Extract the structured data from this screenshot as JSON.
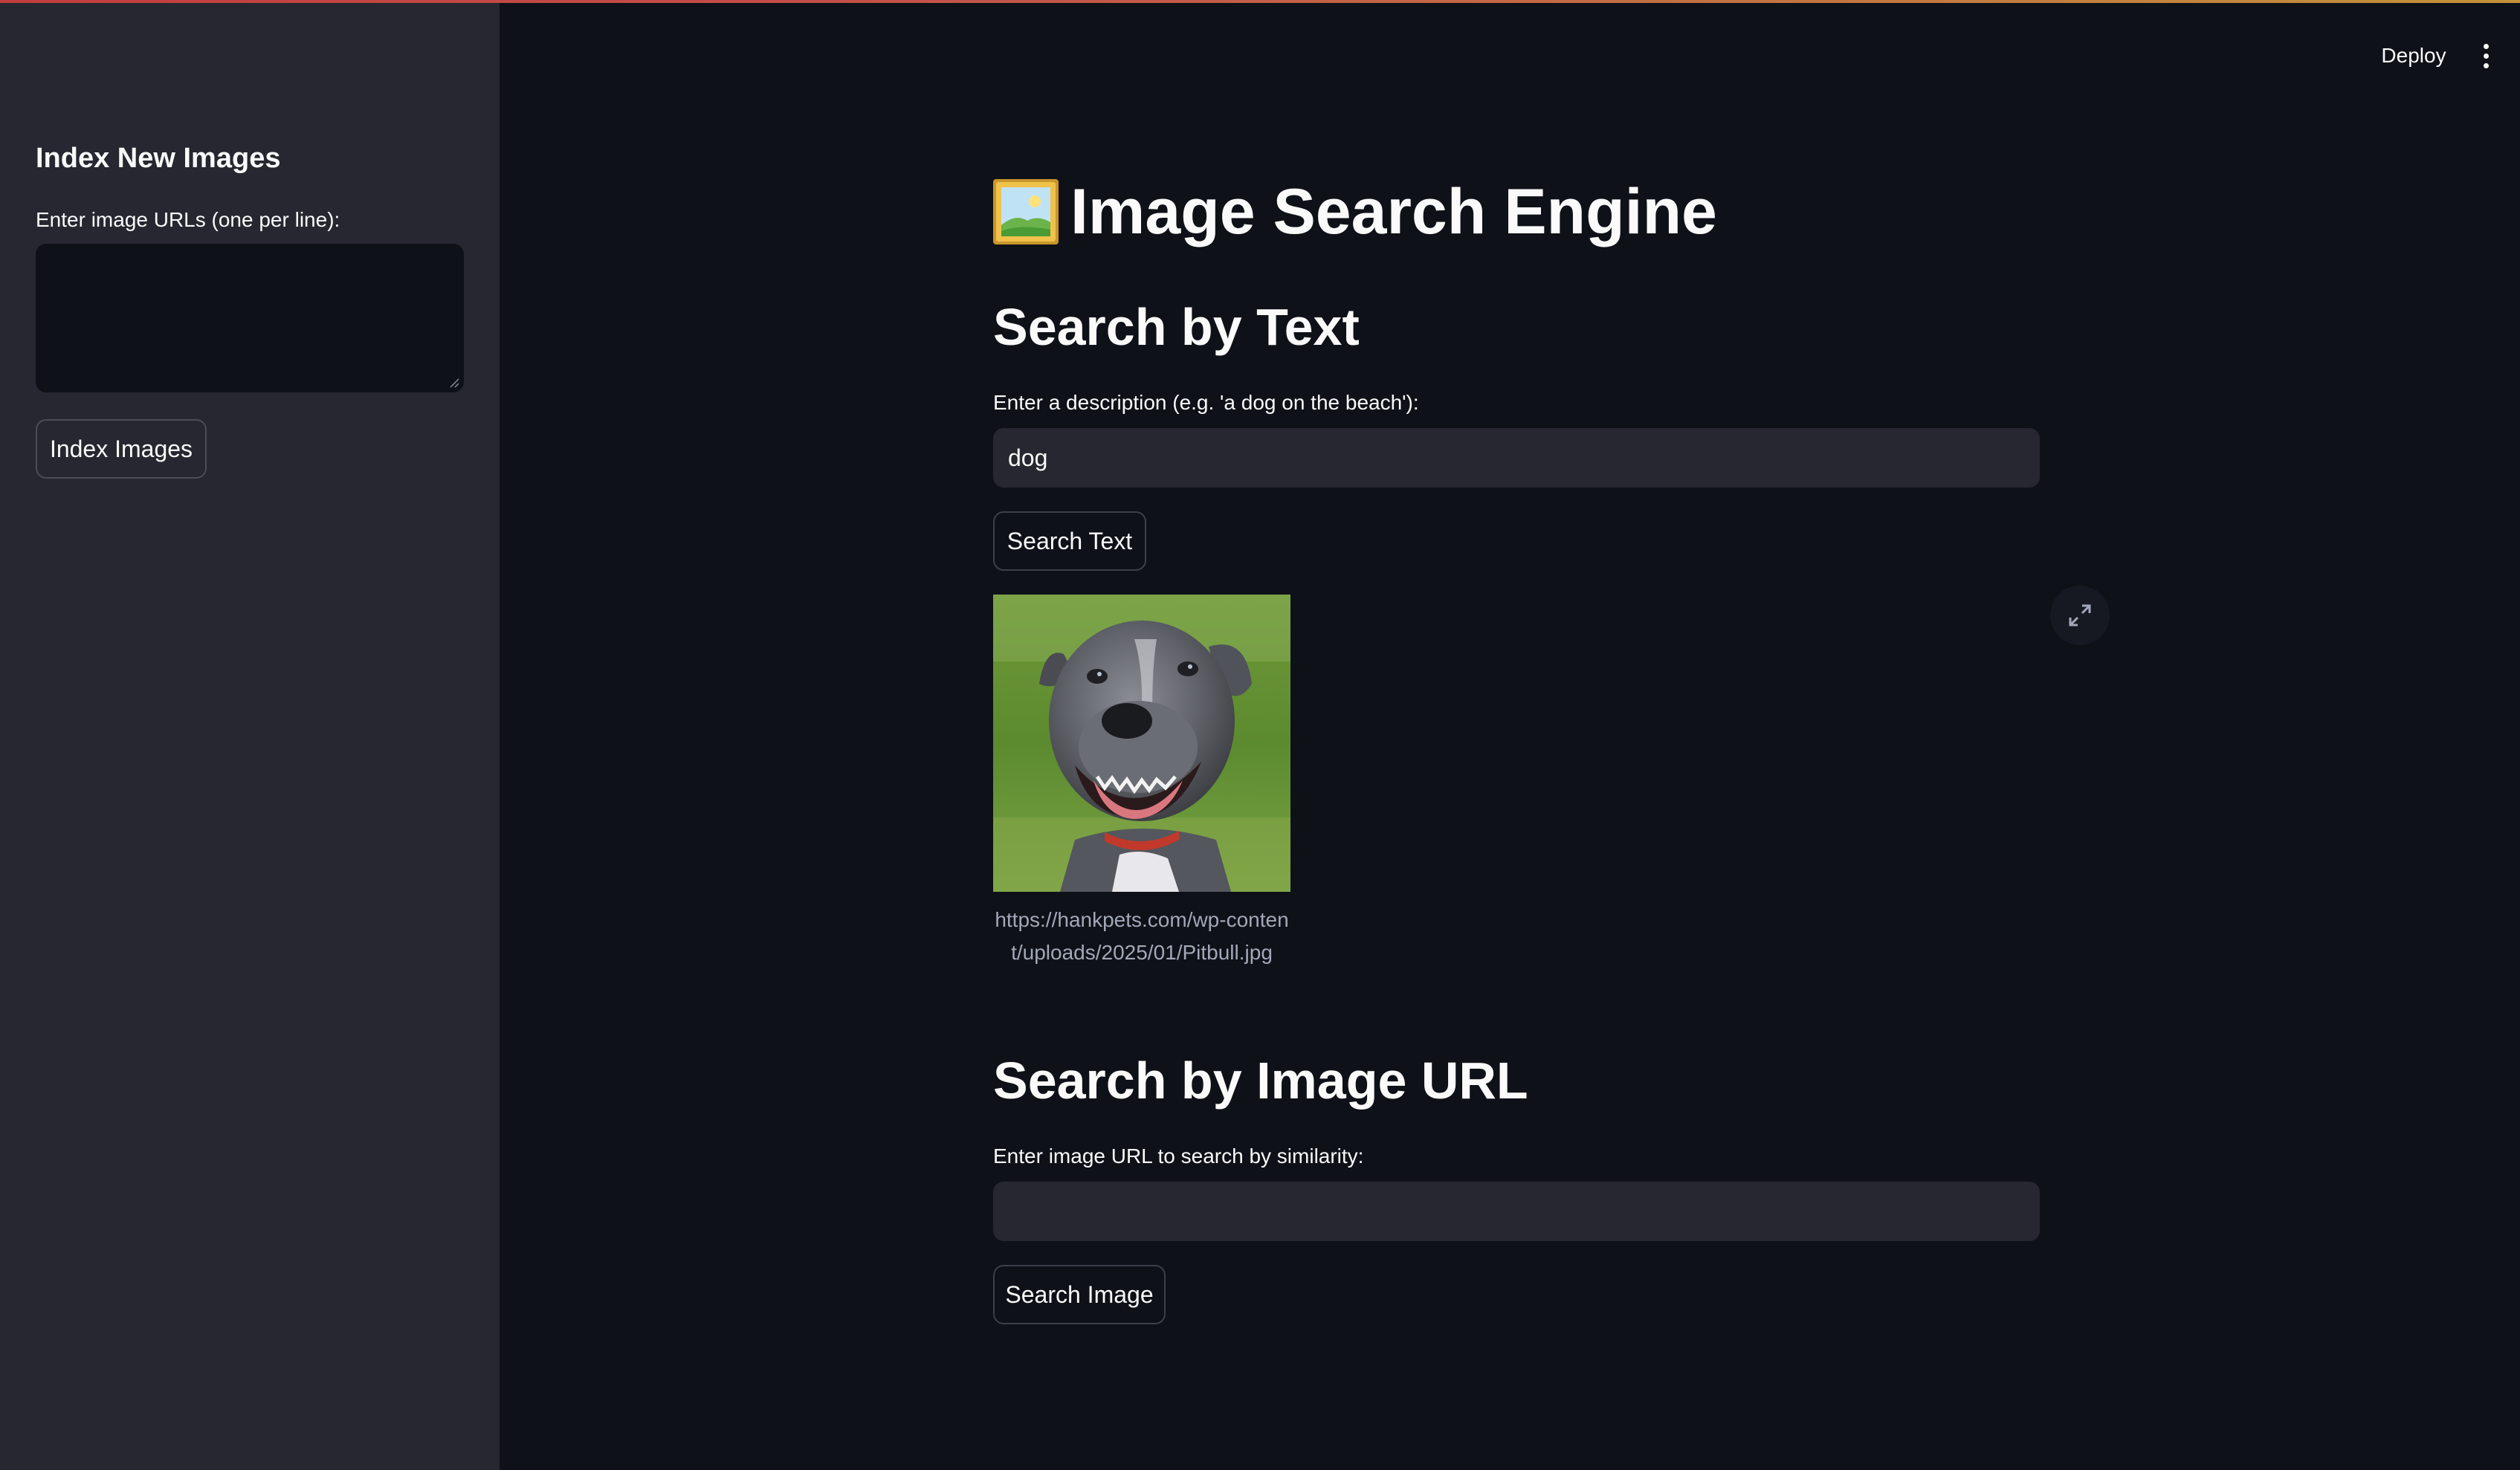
{
  "header": {
    "deploy_label": "Deploy",
    "menu_icon": "vertical-ellipsis-icon"
  },
  "sidebar": {
    "title": "Index New Images",
    "urls_label": "Enter image URLs (one per line):",
    "urls_value": "",
    "index_button_label": "Index Images"
  },
  "main": {
    "title_icon": "framed-picture-icon",
    "title": "Image Search Engine",
    "text_search": {
      "heading": "Search by Text",
      "label": "Enter a description (e.g. 'a dog on the beach'):",
      "value": "dog",
      "button_label": "Search Text"
    },
    "results": [
      {
        "caption": "https://hankpets.com/wp-content/uploads/2025/01/Pitbull.jpg",
        "image_icon": "dog-photo"
      }
    ],
    "fullscreen_icon": "expand-icon",
    "image_search": {
      "heading": "Search by Image URL",
      "label": "Enter image URL to search by similarity:",
      "value": "",
      "button_label": "Search Image"
    }
  },
  "colors": {
    "background": "#0e1117",
    "sidebar": "#262730",
    "input": "#262730",
    "text": "#fafafa",
    "caption": "#a3a8b8"
  }
}
